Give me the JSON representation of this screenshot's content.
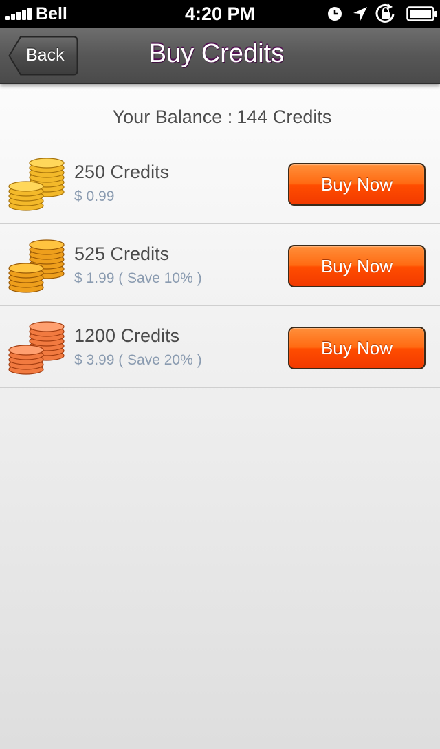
{
  "status_bar": {
    "carrier": "Bell",
    "time": "4:20 PM",
    "icons": [
      "signal-icon",
      "alarm-icon",
      "location-icon",
      "rotation-lock-icon",
      "battery-icon"
    ]
  },
  "nav": {
    "back_label": "Back",
    "title": "Buy Credits"
  },
  "balance": {
    "label": "Your  Balance :",
    "value": "144 Credits"
  },
  "packages": [
    {
      "amount": "250 Credits",
      "price": "$ 0.99",
      "button_label": "Buy Now",
      "icon": "gold-coins-icon",
      "coin_color": "#f3b92a"
    },
    {
      "amount": "525 Credits",
      "price": "$ 1.99 ( Save 10% )",
      "button_label": "Buy Now",
      "icon": "gold-coins-icon",
      "coin_color": "#ee9f1c"
    },
    {
      "amount": "1200 Credits",
      "price": "$ 3.99 ( Save 20% )",
      "button_label": "Buy Now",
      "icon": "copper-coins-icon",
      "coin_color": "#f17a40"
    }
  ],
  "colors": {
    "accent_button": "#ff5a00",
    "nav_bar": "#575757",
    "price_text": "#8a9bb0"
  }
}
